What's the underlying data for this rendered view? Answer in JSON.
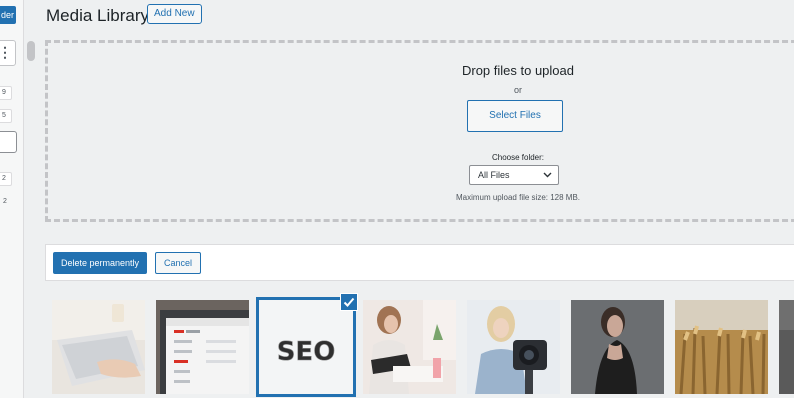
{
  "sidebar": {
    "new_folder_label": "der",
    "more_icon_glyph": "⋮",
    "counts": [
      "9",
      "5",
      "2",
      "2"
    ]
  },
  "header": {
    "title": "Media Library",
    "add_new_label": "Add New"
  },
  "uploader": {
    "title": "Drop files to upload",
    "or_text": "or",
    "select_files_label": "Select Files",
    "choose_folder_label": "Choose folder:",
    "folder_select_value": "All Files",
    "max_size_text": "Maximum upload file size: 128 MB."
  },
  "bulk_actions": {
    "delete_label": "Delete permanently",
    "cancel_label": "Cancel"
  },
  "media_items": [
    {
      "subject": "hand on laptop keyboard",
      "selected": false
    },
    {
      "subject": "laptop showing gmail",
      "selected": false
    },
    {
      "subject": "SEO letters",
      "text": "SEO",
      "selected": true
    },
    {
      "subject": "woman writing at desk",
      "selected": false
    },
    {
      "subject": "woman filming with camera",
      "selected": false
    },
    {
      "subject": "woman portrait on dark background",
      "selected": false
    },
    {
      "subject": "wheat field",
      "selected": false
    },
    {
      "subject": "partial image",
      "selected": false
    }
  ],
  "colors": {
    "accent": "#2271b1",
    "background": "#eef0f1"
  }
}
